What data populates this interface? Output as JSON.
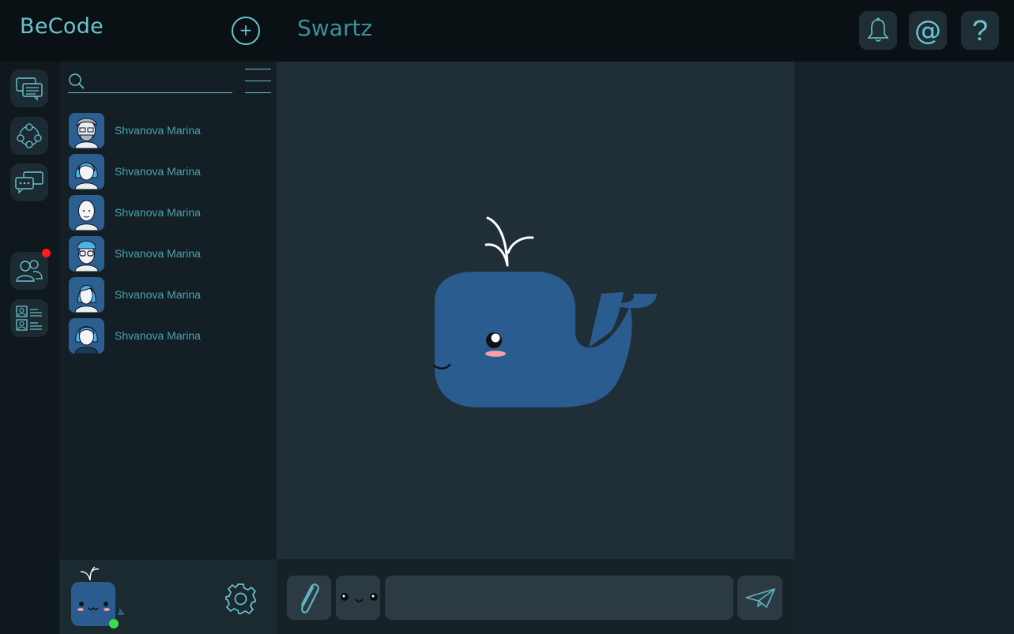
{
  "app": {
    "brand": "BeCode",
    "chat_title": "Swartz"
  },
  "header": {
    "add_label": "+",
    "icons": [
      "bell-icon",
      "at-icon",
      "help-icon"
    ],
    "at_label": "@",
    "help_label": "?"
  },
  "rail": {
    "items": [
      "chats-icon",
      "groups-icon",
      "messages-icon",
      "contacts-icon",
      "directory-icon"
    ],
    "notification": true
  },
  "search": {
    "value": "",
    "placeholder": ""
  },
  "contacts": [
    {
      "name": "Shvanova Marina"
    },
    {
      "name": "Shvanova Marina"
    },
    {
      "name": "Shvanova Marina"
    },
    {
      "name": "Shvanova Marina"
    },
    {
      "name": "Shvanova Marina"
    },
    {
      "name": "Shvanova Marina"
    }
  ],
  "composer": {
    "value": "",
    "placeholder": ""
  },
  "status": {
    "online": true
  },
  "colors": {
    "accent": "#6cc3cf",
    "whale": "#2a5c8f",
    "online": "#3ddc4a",
    "notification": "#ff1a1a"
  }
}
